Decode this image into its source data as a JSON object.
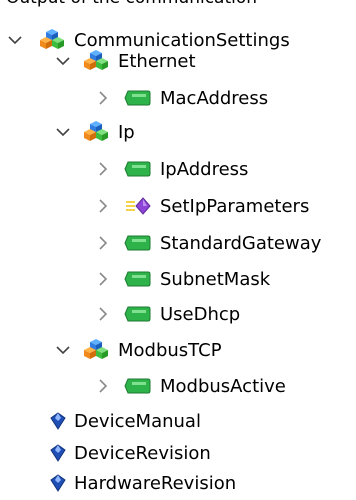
{
  "header": {
    "clipped_text": "Output of the communication"
  },
  "tree": {
    "communication_settings": {
      "label": "CommunicationSettings"
    },
    "ethernet": {
      "label": "Ethernet"
    },
    "mac_address": {
      "label": "MacAddress"
    },
    "ip": {
      "label": "Ip"
    },
    "ip_address": {
      "label": "IpAddress"
    },
    "set_ip_parameters": {
      "label": "SetIpParameters"
    },
    "standard_gateway": {
      "label": "StandardGateway"
    },
    "subnet_mask": {
      "label": "SubnetMask"
    },
    "use_dhcp": {
      "label": "UseDhcp"
    },
    "modbus_tcp": {
      "label": "ModbusTCP"
    },
    "modbus_active": {
      "label": "ModbusActive"
    },
    "device_manual": {
      "label": "DeviceManual"
    },
    "device_revision": {
      "label": "DeviceRevision"
    },
    "hardware_revision": {
      "label": "HardwareRevision"
    }
  },
  "icons": {
    "group": "cube-cluster-icon",
    "variable": "green-tag-icon",
    "method": "purple-diamond-method-icon",
    "property": "blue-gem-icon",
    "expanded": "chevron-down-icon",
    "collapsed": "chevron-right-icon"
  },
  "colors": {
    "chevron_expanded": "#444444",
    "chevron_collapsed": "#8a8a8a",
    "tag_green": "#2db34a",
    "cube_blue": "#2f7de1",
    "cube_orange": "#f08a1c",
    "cube_green": "#3dbd3d",
    "gem_blue": "#1f4fb5",
    "method_purple": "#8e44d6"
  }
}
